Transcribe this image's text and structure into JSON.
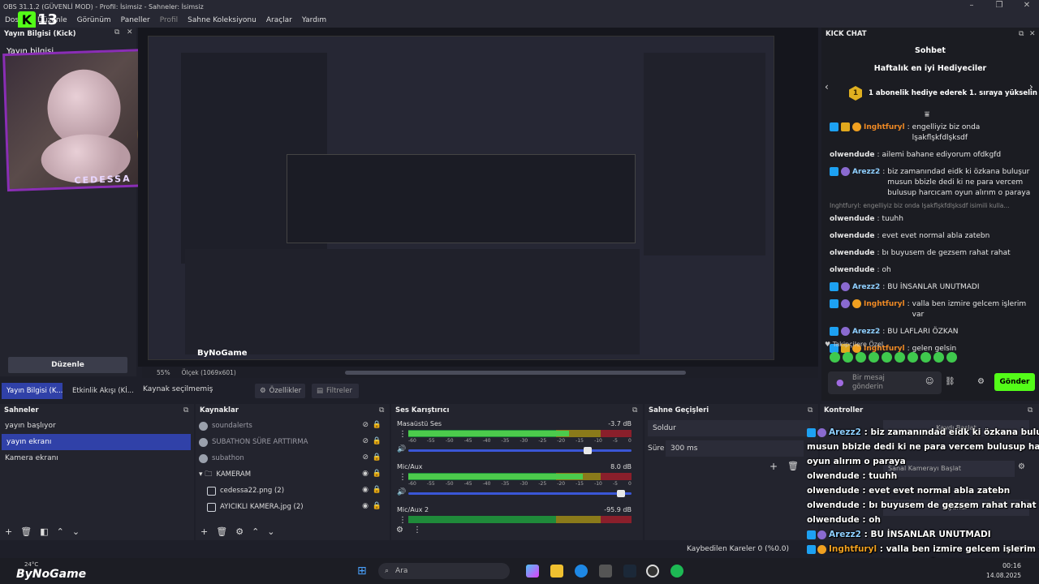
{
  "window": {
    "title": "OBS 31.1.2 (GÜVENLİ MOD) - Profil: İsimsiz - Sahneler: İsimsiz"
  },
  "menu": [
    "Dosya",
    "Düzenle",
    "Görünüm",
    "Paneller",
    "Profil",
    "Sahne Koleksiyonu",
    "Araçlar",
    "Yardım"
  ],
  "left_dock": {
    "title": "Yayın Bilgisi (Kick)",
    "overlay_label": "Yayın bilgisi",
    "logo_text": "K",
    "logo_number": "13",
    "frame_name": "CEDESSA",
    "edit_button": "Düzenle"
  },
  "tabs": {
    "tab1": "Yayın Bilgisi (K...",
    "tab2": "Etkinlik Akışı (Kİ..."
  },
  "preview": {
    "zoom": "55%",
    "canvas": "Ölçek (1069x601)",
    "nested_logo": "ByNoGame"
  },
  "context_bar": {
    "no_source": "Kaynak seçilmemiş",
    "properties": "Özellikler",
    "filters": "Filtreler"
  },
  "scenes": {
    "title": "Sahneler",
    "items": [
      "yayın başlıyor",
      "yayın ekranı",
      "Kamera ekranı"
    ],
    "selected_index": 1
  },
  "sources": {
    "title": "Kaynaklar",
    "items": [
      {
        "name": "soundalerts",
        "type": "circle",
        "visible": false
      },
      {
        "name": "SUBATHON SÜRE ARTTIRMA",
        "type": "circle",
        "visible": false
      },
      {
        "name": "subathon",
        "type": "circle",
        "visible": false
      },
      {
        "name": "KAMERAM",
        "type": "folder",
        "visible": true
      },
      {
        "name": "cedessa22.png (2)",
        "type": "image",
        "visible": true
      },
      {
        "name": "AYICIKLI KAMERA.jpg (2)",
        "type": "image",
        "visible": true
      }
    ]
  },
  "mixer": {
    "title": "Ses Karıştırıcı",
    "channels": [
      {
        "name": "Masaüstü Ses",
        "db": "-3.7 dB",
        "level": 0.72,
        "volume": 0.82
      },
      {
        "name": "Mic/Aux",
        "db": "8.0 dB",
        "level": 0.78,
        "volume": 0.97
      },
      {
        "name": "Mic/Aux 2",
        "db": "-95.9 dB",
        "level": 0.0,
        "volume": 0.0
      }
    ],
    "scale": [
      "-60",
      "-55",
      "-50",
      "-45",
      "-40",
      "-35",
      "-30",
      "-25",
      "-20",
      "-15",
      "-10",
      "-5",
      "0"
    ]
  },
  "transitions": {
    "title": "Sahne Geçişleri",
    "transition": "Soldur",
    "duration_label": "Süre",
    "duration_value": "300 ms"
  },
  "controls": {
    "title": "Kontroller",
    "buttons": [
      "Kaydı Başlat",
      "Sanal Kamerayı Başlat",
      "Ayarlar"
    ]
  },
  "kick_chat": {
    "title": "KICK CHAT",
    "header": "Sohbet",
    "leaderboard": "Haftalık en iyi Hediyeciler",
    "promo": "1 abonelik hediye ederek 1. sıraya yükselin",
    "promo_rank": "1",
    "messages": [
      {
        "user": "Inghtfuryl",
        "color": "#f08a24",
        "badges": [
          "blue",
          "gold",
          "orange"
        ],
        "text": "engelliyiz biz onda lşakflşkfdlşksdf"
      },
      {
        "user": "olwendude",
        "color": "#e6e6e6",
        "badges": [],
        "text": "ailemi bahane ediyorum ofdkgfd"
      },
      {
        "user": "Arezz2",
        "color": "#8ecfff",
        "badges": [
          "blue",
          "purple"
        ],
        "text": "biz zamanındad eidk ki özkana buluşur musun bbizle dedi ki ne para vercem bulusup harcıcam oyun alırım o paraya"
      },
      {
        "user": "olwendude",
        "color": "#e6e6e6",
        "badges": [],
        "text": "tuuhh"
      },
      {
        "user": "olwendude",
        "color": "#e6e6e6",
        "badges": [],
        "text": "evet evet normal abla zatebn"
      },
      {
        "user": "olwendude",
        "color": "#e6e6e6",
        "badges": [],
        "text": "bı buyusem de gezsem rahat rahat"
      },
      {
        "user": "olwendude",
        "color": "#e6e6e6",
        "badges": [],
        "text": "oh"
      },
      {
        "user": "Arezz2",
        "color": "#8ecfff",
        "badges": [
          "blue",
          "purple"
        ],
        "text": "BU İNSANLAR UNUTMADI"
      },
      {
        "user": "Inghtfuryl",
        "color": "#f08a24",
        "badges": [
          "blue",
          "purple",
          "orange"
        ],
        "text": "valla ben izmire gelcem işlerim var"
      },
      {
        "user": "Arezz2",
        "color": "#8ecfff",
        "badges": [
          "blue",
          "purple"
        ],
        "text": "BU LAFLARI ÖZKAN"
      },
      {
        "user": "Inghtfuryl",
        "color": "#f08a24",
        "badges": [
          "blue",
          "gold",
          "orange"
        ],
        "text": "gelen gelsin"
      }
    ],
    "reply_preview": "Inghtfuryl: engelliyiz biz onda lşakflşkfdlşksdf isimili kulla...",
    "followers_label": "Takipçilere Özel",
    "input_placeholder": "Bir mesaj gönderin",
    "send_button": "Gönder"
  },
  "overlay_chat": [
    {
      "user": "Arezz2",
      "kind": "a",
      "text": "biz zamanındad eidk ki özkana buluşur"
    },
    {
      "user": "",
      "kind": "",
      "text": "musun bbizle dedi ki ne para vercem bulusup harcıcam"
    },
    {
      "user": "",
      "kind": "",
      "text": "oyun alırım o paraya"
    },
    {
      "user": "olwendude",
      "kind": "w",
      "text": "tuuhh"
    },
    {
      "user": "olwendude",
      "kind": "w",
      "text": "evet evet normal abla zatebn"
    },
    {
      "user": "olwendude",
      "kind": "w",
      "text": "bı buyusem de gezsem rahat rahat"
    },
    {
      "user": "olwendude",
      "kind": "w",
      "text": "oh"
    },
    {
      "user": "Arezz2",
      "kind": "a",
      "text": "BU İNSANLAR UNUTMADI"
    },
    {
      "user": "Inghtfuryl",
      "kind": "o",
      "text": "valla ben izmire gelcem işlerim var"
    },
    {
      "user": "Arezz2",
      "kind": "a",
      "text": "BU LAFLARI ÖZKAN"
    },
    {
      "user": "Inghtfuryl",
      "kind": "o",
      "text": "gelen gelsin"
    }
  ],
  "status": {
    "dropped": "Kaybedilen Kareler 0 (%0.0)",
    "fps": "FPS"
  },
  "taskbar": {
    "weather": "24°C",
    "logo": "ByNoGame",
    "search": "Ara",
    "time": "00:16",
    "date": "14.08.2025"
  },
  "colors": {
    "accent": "#3041a8",
    "kick_green": "#53fc18",
    "frame_purple": "#8a2eb5"
  }
}
